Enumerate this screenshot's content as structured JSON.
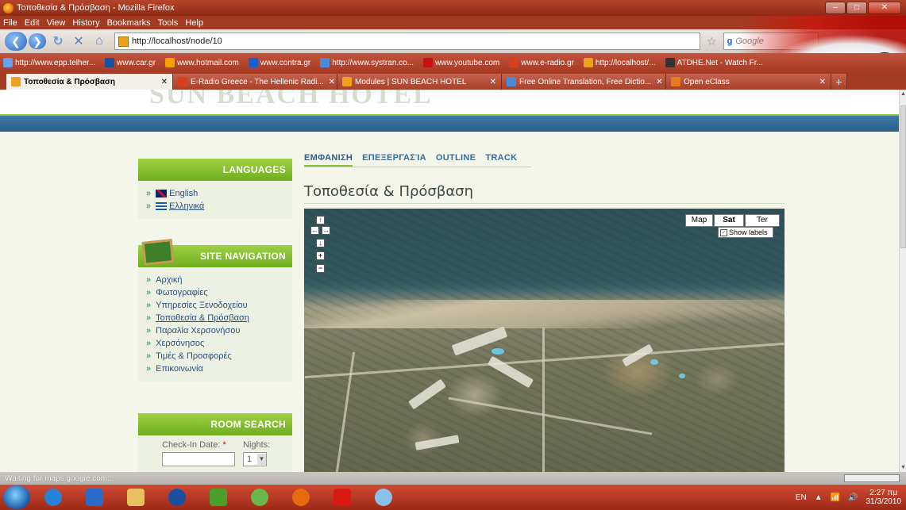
{
  "window": {
    "title": "Τοποθεσία & Πρόσβαση - Mozilla Firefox"
  },
  "menubar": [
    "File",
    "Edit",
    "View",
    "History",
    "Bookmarks",
    "Tools",
    "Help"
  ],
  "navbar": {
    "url": "http://localhost/node/10",
    "search_placeholder": "Google",
    "search_engine": "Google"
  },
  "bookmarks": [
    "http://www.epp.telher...",
    "www.car.gr",
    "www.hotmail.com",
    "www.contra.gr",
    "http://www.systran.co...",
    "www.youtube.com",
    "www.e-radio.gr",
    "http://localhost/...",
    "ATDHE.Net - Watch Fr..."
  ],
  "tabs": [
    {
      "label": "Τοποθεσία & Πρόσβαση",
      "active": true
    },
    {
      "label": "E-Radio Greece - The Hellenic Radi...",
      "active": false
    },
    {
      "label": "Modules | SUN BEACH HOTEL",
      "active": false
    },
    {
      "label": "Free Online Translation, Free Dictio...",
      "active": false
    },
    {
      "label": "Open eClass",
      "active": false
    }
  ],
  "site": {
    "logo_text": "SUN BEACH HOTEL",
    "languages": {
      "title": "LANGUAGES",
      "items": [
        "English",
        "Ελληνικά"
      ]
    },
    "site_navigation": {
      "title": "SITE NAVIGATION",
      "items": [
        "Αρχική",
        "Φωτογραφίες",
        "Υπηρεσίες Ξενοδοχείου",
        "Τοποθεσία & Πρόσβαση",
        "Παραλία Χερσονήσου",
        "Χερσόνησος",
        "Τιμές & Προσφορές",
        "Επικοινωνία"
      ],
      "current_index": 3
    },
    "room_search": {
      "title": "ROOM SEARCH",
      "checkin_label": "Check-In Date:",
      "required_mark": "*",
      "checkin_value": "",
      "nights_label": "Nights:",
      "nights_value": "1"
    },
    "content_tabs": [
      "ΕΜΦΑΝΙΣΗ",
      "ΕΠΕΞΕΡΓΑΣΊΑ",
      "OUTLINE",
      "TRACK"
    ],
    "page_title": "Τοποθεσία & Πρόσβαση",
    "map": {
      "type_buttons": [
        "Map",
        "Sat",
        "Ter"
      ],
      "selected_type": "Sat",
      "show_labels": "Show labels",
      "show_labels_checked": true
    }
  },
  "status": {
    "text": "Waiting for maps.google.com..."
  },
  "taskbar": {
    "lang": "EN",
    "time": "2:27 πμ",
    "date": "31/3/2010"
  },
  "colors": {
    "accent_green": "#8bbf3a",
    "blue_band": "#2f6a96",
    "link_blue": "#2d4f7c"
  }
}
